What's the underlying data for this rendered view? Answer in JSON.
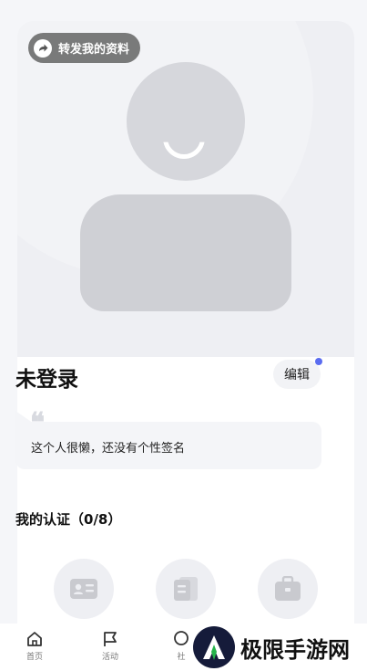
{
  "share": {
    "label": "转发我的资料",
    "icon": "share-arrow-icon"
  },
  "profile": {
    "name": "未登录",
    "edit_label": "编辑",
    "signature": "这个人很懒，还没有个性签名"
  },
  "certification": {
    "title": "我的认证（0/8）",
    "icons": [
      "id-card-icon",
      "document-icon",
      "briefcase-icon"
    ]
  },
  "tabbar": {
    "items": [
      {
        "label": "首页",
        "icon": "home-icon"
      },
      {
        "label": "活动",
        "icon": "flag-icon"
      },
      {
        "label": "社",
        "icon": "community-icon"
      }
    ]
  },
  "watermark": {
    "text": "极限手游网"
  },
  "colors": {
    "notification_dot": "#5a6cf0",
    "avatar_placeholder": "#d6d7dc",
    "hero_bg": "#eeeff3"
  }
}
